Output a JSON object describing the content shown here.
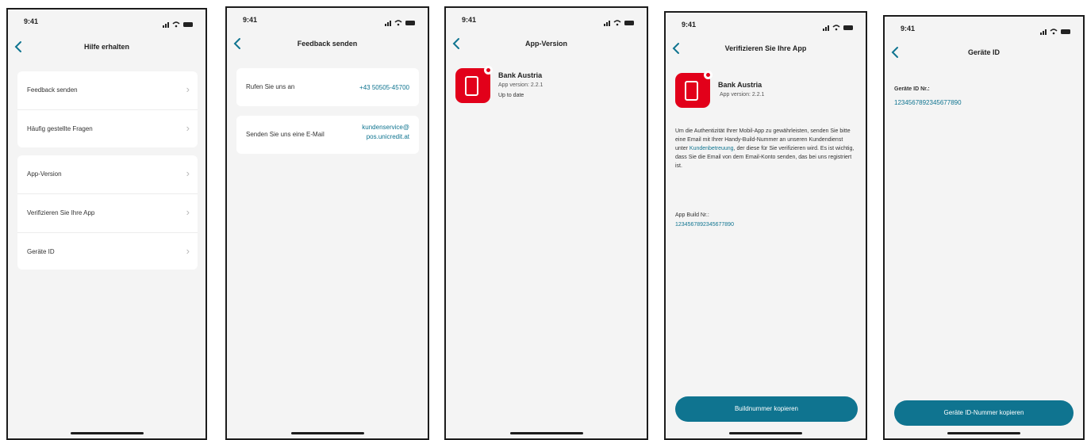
{
  "status": {
    "time": "9:41"
  },
  "screen1": {
    "title": "Hilfe erhalten",
    "group1": [
      {
        "label": "Feedback senden"
      },
      {
        "label": "Häufig gestellte Fragen"
      }
    ],
    "group2": [
      {
        "label": "App-Version"
      },
      {
        "label": "Verifizieren Sie Ihre App"
      },
      {
        "label": "Geräte ID"
      }
    ]
  },
  "screen2": {
    "title": "Feedback senden",
    "phone_label": "Rufen Sie uns an",
    "phone_value": "+43 50505-45700",
    "email_label": "Senden Sie uns eine E-Mail",
    "email_value_line1": "kundenservice@",
    "email_value_line2": "pos.unicredit.at"
  },
  "screen3": {
    "title": "App-Version",
    "app_name": "Bank Austria",
    "version": "App version: 2.2.1",
    "status": "Up to date"
  },
  "screen4": {
    "title": "Verifizieren Sie Ihre App",
    "app_name": "Bank Austria",
    "version": "App version: 2.2.1",
    "para_part1": "Um die Authentizität Ihrer Mobil-App zu gewährleisten, senden Sie bitte eine Email mit Ihrer Handy-Build-Nummer an unseren Kundendienst unter ",
    "para_link": "Kundenbetreuung",
    "para_part2": ", der diese für Sie verifizieren wird. Es ist wichtig, dass Sie die Email von dem Email-Konto senden, das bei uns registriert ist.",
    "build_label": "App Build Nr.:",
    "build_value": "12345678923456778​90",
    "button": "Buildnummer kopieren"
  },
  "screen5": {
    "title": "Geräte ID",
    "id_label": "Geräte ID Nr.:",
    "id_value": "1234567892345677890",
    "button": "Geräte ID-Nummer kopieren"
  },
  "colors": {
    "accent": "#0f7490",
    "brand": "#e2001a"
  }
}
